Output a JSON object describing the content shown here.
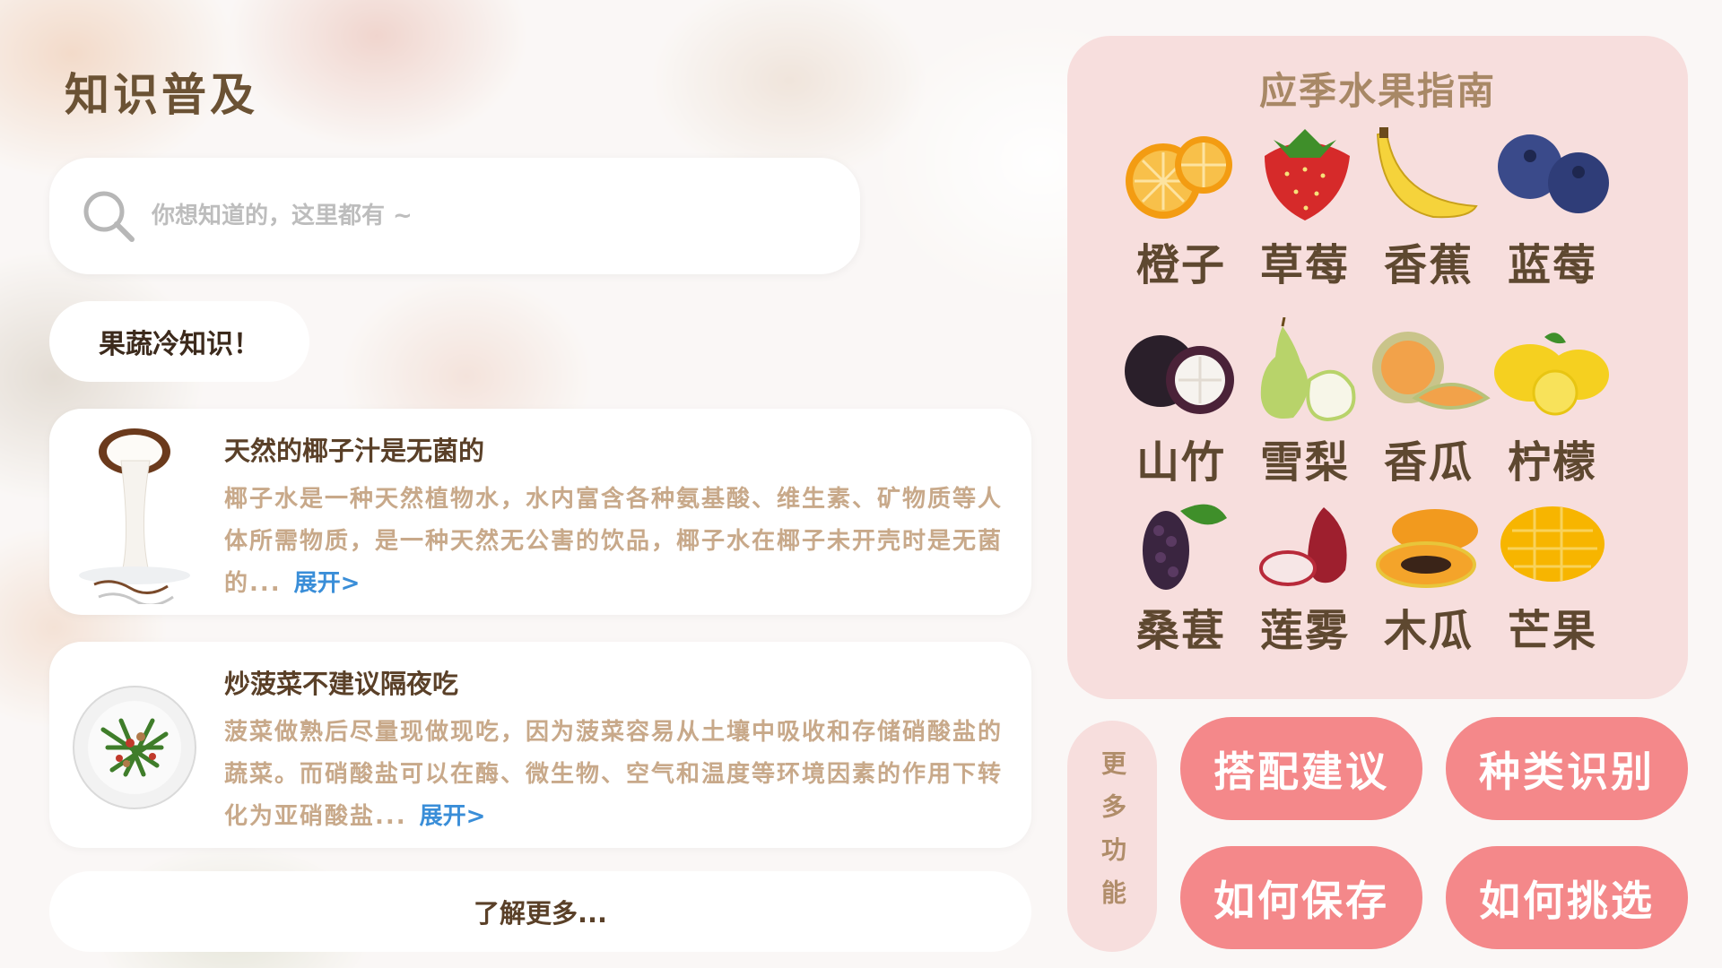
{
  "header": {
    "title": "知识普及"
  },
  "search": {
    "placeholder": "你想知道的，这里都有 ~"
  },
  "section_tag": "果蔬冷知识！",
  "articles": [
    {
      "title": "天然的椰子汁是无菌的",
      "body": "椰子水是一种天然植物水，水内富含各种氨基酸、维生素、矿物质等人体所需物质，是一种天然无公害的饮品，椰子水在椰子未开壳时是无菌的...",
      "expand": "展开>"
    },
    {
      "title": "炒菠菜不建议隔夜吃",
      "body": "菠菜做熟后尽量现做现吃，因为菠菜容易从土壤中吸收和存储硝酸盐的蔬菜。而硝酸盐可以在酶、微生物、空气和温度等环境因素的作用下转化为亚硝酸盐...",
      "expand": "展开>"
    }
  ],
  "more_link": "了解更多...",
  "guide": {
    "title": "应季水果指南",
    "fruits": [
      {
        "name": "橙子",
        "icon": "orange-icon"
      },
      {
        "name": "草莓",
        "icon": "strawberry-icon"
      },
      {
        "name": "香蕉",
        "icon": "banana-icon"
      },
      {
        "name": "蓝莓",
        "icon": "blueberry-icon"
      },
      {
        "name": "山竹",
        "icon": "mangosteen-icon"
      },
      {
        "name": "雪梨",
        "icon": "pear-icon"
      },
      {
        "name": "香瓜",
        "icon": "melon-icon"
      },
      {
        "name": "柠檬",
        "icon": "lemon-icon"
      },
      {
        "name": "桑葚",
        "icon": "mulberry-icon"
      },
      {
        "name": "莲雾",
        "icon": "wax-apple-icon"
      },
      {
        "name": "木瓜",
        "icon": "papaya-icon"
      },
      {
        "name": "芒果",
        "icon": "mango-icon"
      }
    ]
  },
  "more_functions": {
    "label": "更多功能",
    "buttons": [
      "搭配建议",
      "种类识别",
      "如何保存",
      "如何挑选"
    ]
  },
  "colors": {
    "title_brown": "#6b5234",
    "body_tan": "#c8a98a",
    "link_blue": "#3a8ed8",
    "panel_pink": "#f7dedd",
    "button_pink": "#f4888a"
  }
}
